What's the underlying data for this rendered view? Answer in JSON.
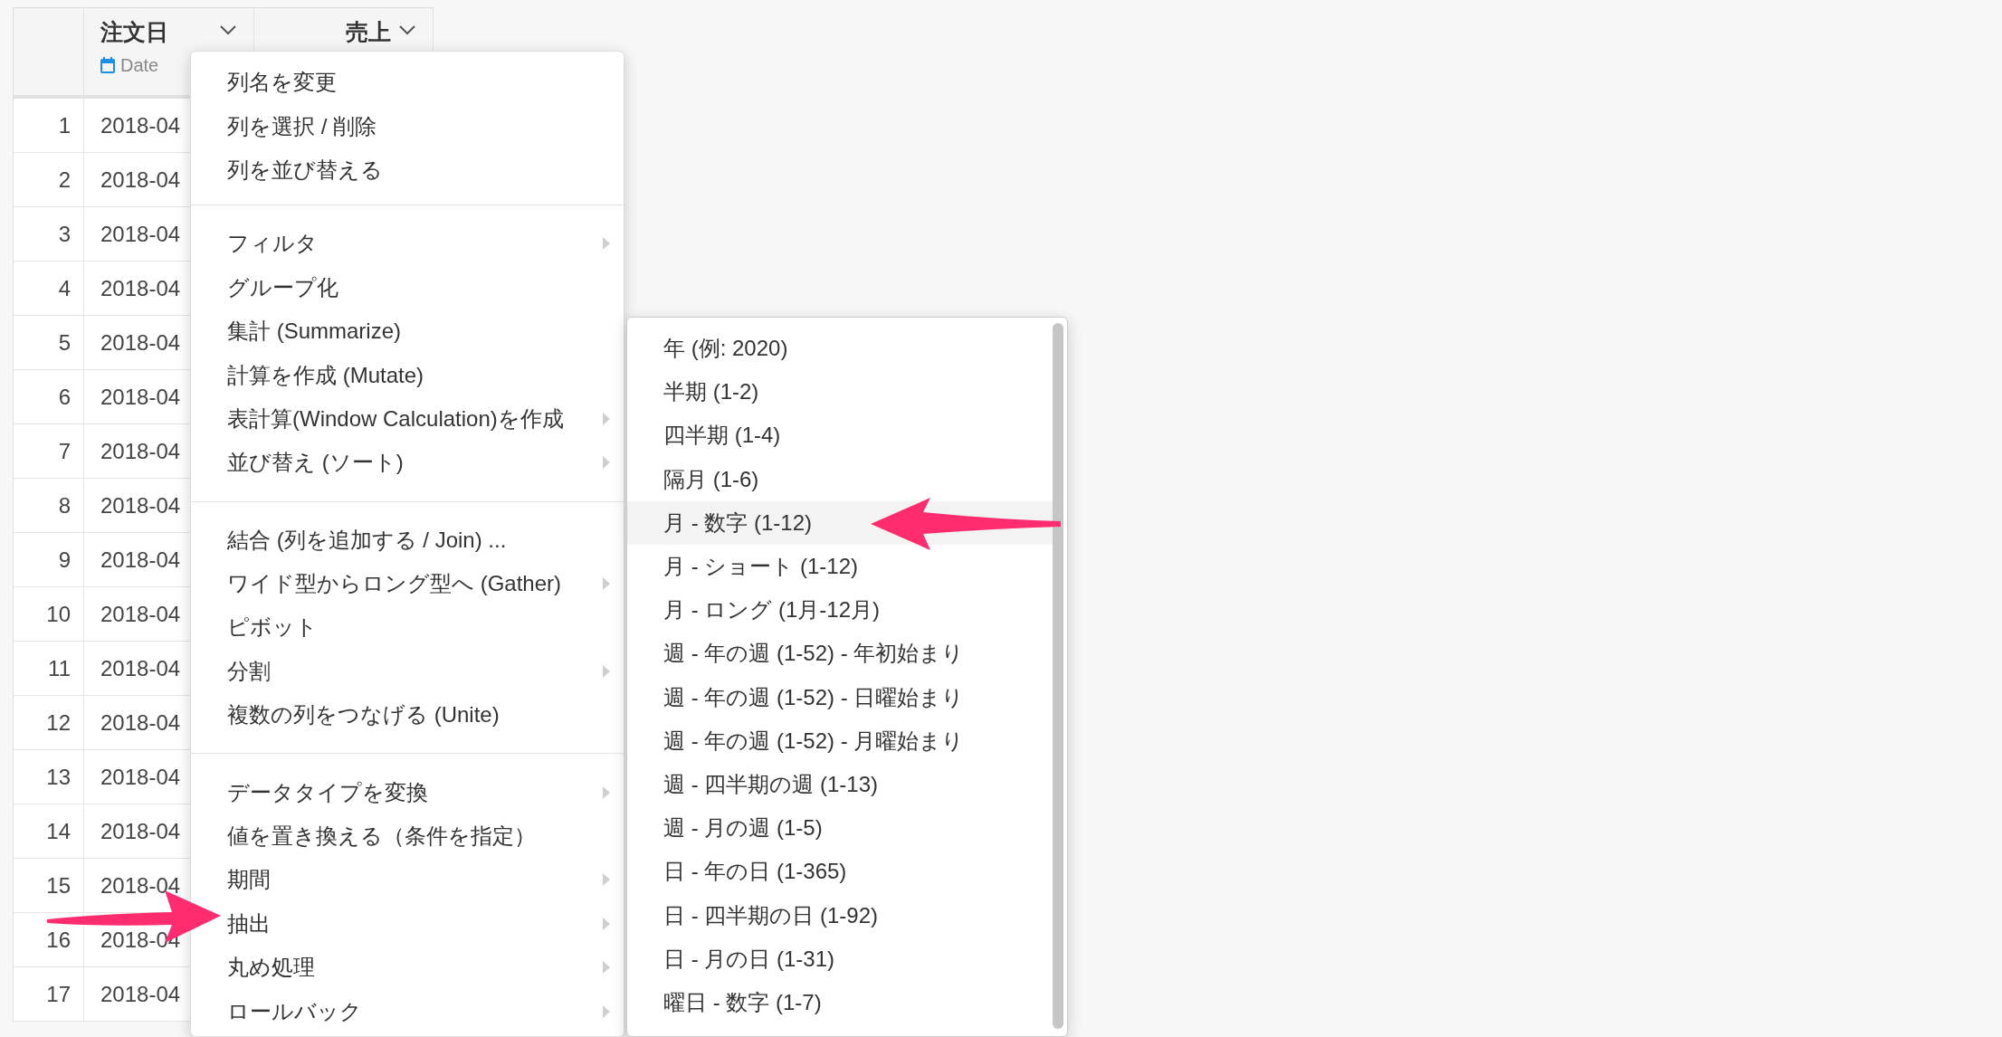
{
  "table": {
    "columns": [
      {
        "title": "注文日",
        "type_label": "Date",
        "kind": "date"
      },
      {
        "title": "売上",
        "kind": "number"
      }
    ],
    "rows": [
      {
        "number": "1",
        "cells": [
          "2018-04"
        ]
      },
      {
        "number": "2",
        "cells": [
          "2018-04"
        ]
      },
      {
        "number": "3",
        "cells": [
          "2018-04"
        ]
      },
      {
        "number": "4",
        "cells": [
          "2018-04"
        ]
      },
      {
        "number": "5",
        "cells": [
          "2018-04"
        ]
      },
      {
        "number": "6",
        "cells": [
          "2018-04"
        ]
      },
      {
        "number": "7",
        "cells": [
          "2018-04"
        ]
      },
      {
        "number": "8",
        "cells": [
          "2018-04"
        ]
      },
      {
        "number": "9",
        "cells": [
          "2018-04"
        ]
      },
      {
        "number": "10",
        "cells": [
          "2018-04"
        ]
      },
      {
        "number": "11",
        "cells": [
          "2018-04"
        ]
      },
      {
        "number": "12",
        "cells": [
          "2018-04"
        ]
      },
      {
        "number": "13",
        "cells": [
          "2018-04"
        ]
      },
      {
        "number": "14",
        "cells": [
          "2018-04"
        ]
      },
      {
        "number": "15",
        "cells": [
          "2018-04"
        ]
      },
      {
        "number": "16",
        "cells": [
          "2018-04"
        ]
      },
      {
        "number": "17",
        "cells": [
          "2018-04"
        ]
      }
    ]
  },
  "context_menu": {
    "groups": [
      [
        {
          "label": "列名を変更",
          "has_submenu": false
        },
        {
          "label": "列を選択 / 削除",
          "has_submenu": false
        },
        {
          "label": "列を並び替える",
          "has_submenu": false
        }
      ],
      [
        {
          "label": "フィルタ",
          "has_submenu": true
        },
        {
          "label": "グループ化",
          "has_submenu": false
        },
        {
          "label": "集計 (Summarize)",
          "has_submenu": false
        },
        {
          "label": "計算を作成 (Mutate)",
          "has_submenu": false
        },
        {
          "label": "表計算(Window Calculation)を作成",
          "has_submenu": true
        },
        {
          "label": "並び替え (ソート)",
          "has_submenu": true
        }
      ],
      [
        {
          "label": "結合 (列を追加する / Join) ...",
          "has_submenu": false
        },
        {
          "label": "ワイド型からロング型へ (Gather)",
          "has_submenu": true
        },
        {
          "label": "ピボット",
          "has_submenu": false
        },
        {
          "label": "分割",
          "has_submenu": true
        },
        {
          "label": "複数の列をつなげる (Unite)",
          "has_submenu": false
        }
      ],
      [
        {
          "label": "データタイプを変換",
          "has_submenu": true
        },
        {
          "label": "値を置き換える（条件を指定）",
          "has_submenu": false
        },
        {
          "label": "期間",
          "has_submenu": true
        },
        {
          "label": "抽出",
          "has_submenu": true
        },
        {
          "label": "丸め処理",
          "has_submenu": true
        },
        {
          "label": "ロールバック",
          "has_submenu": true
        }
      ]
    ]
  },
  "submenu": {
    "items": [
      {
        "label": "年 (例: 2020)",
        "selected": false
      },
      {
        "label": "半期 (1-2)",
        "selected": false
      },
      {
        "label": "四半期 (1-4)",
        "selected": false
      },
      {
        "label": "隔月 (1-6)",
        "selected": false
      },
      {
        "label": "月 - 数字 (1-12)",
        "selected": true
      },
      {
        "label": "月 - ショート (1-12)",
        "selected": false
      },
      {
        "label": "月 - ロング (1月-12月)",
        "selected": false
      },
      {
        "label": "週 - 年の週 (1-52) - 年初始まり",
        "selected": false
      },
      {
        "label": "週 - 年の週 (1-52) - 日曜始まり",
        "selected": false
      },
      {
        "label": "週 - 年の週 (1-52) - 月曜始まり",
        "selected": false
      },
      {
        "label": "週 - 四半期の週 (1-13)",
        "selected": false
      },
      {
        "label": "週 - 月の週 (1-5)",
        "selected": false
      },
      {
        "label": "日 - 年の日 (1-365)",
        "selected": false
      },
      {
        "label": "日 - 四半期の日 (1-92)",
        "selected": false
      },
      {
        "label": "日 - 月の日 (1-31)",
        "selected": false
      },
      {
        "label": "曜日 - 数字 (1-7)",
        "selected": false
      }
    ]
  }
}
